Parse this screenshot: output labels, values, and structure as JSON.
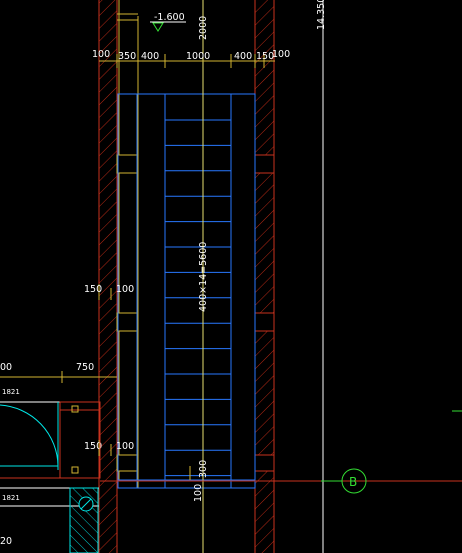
{
  "drawing": {
    "elevation_label": "-1.600",
    "top_total_dim": "2000",
    "side_dim_left": "100",
    "side_dim_right": "100",
    "dim_350": "350",
    "dim_400_left": "400",
    "dim_1000": "1000",
    "dim_400_right": "400",
    "dim_150_right": "150",
    "stair_run_label": "400×14=5600",
    "left_dim_150_upper": "150",
    "left_dim_100_upper": "100",
    "left_dim_partial": "00",
    "left_dim_750": "750",
    "door_tag_upper": "1821",
    "door_tag_lower": "1821",
    "left_dim_150_lower": "150",
    "left_dim_100_lower": "100",
    "bottom_dim_300": "300",
    "bottom_dim_100": "100",
    "bottom_left_partial": "20",
    "elevation_right": "14.350",
    "axis_bubble_label": "B"
  },
  "colors": {
    "background": "#000000",
    "wall": "#c8321e",
    "wall_hatch": "#b42814",
    "stair": "#2878ff",
    "centerline": "#e8e070",
    "dimension": "#ffffff",
    "axis": "#33dd33",
    "equipment": "#00e6e6"
  }
}
